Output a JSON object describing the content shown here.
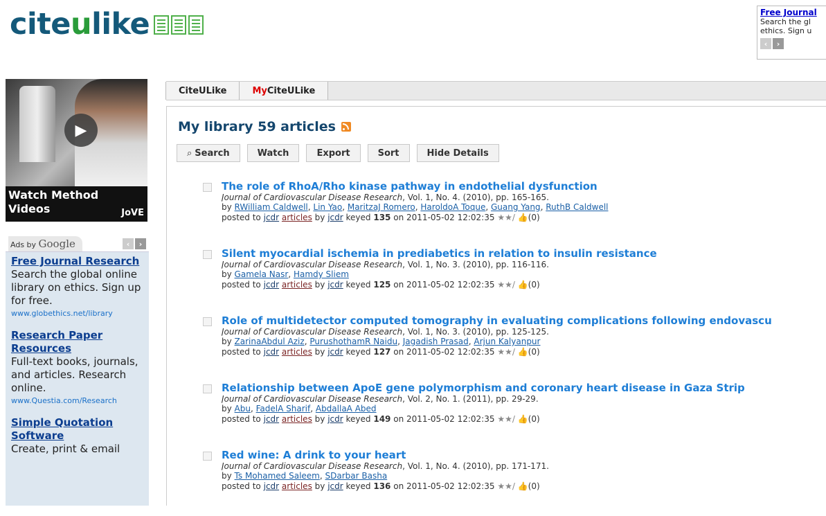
{
  "logo": {
    "pre": "cite",
    "u": "u",
    "post": "like"
  },
  "top_ad": {
    "title": "Free Journal",
    "line1": "Search the gl",
    "line2": "ethics. Sign u"
  },
  "video": {
    "caption_line1": "Watch Method",
    "caption_line2": "Videos",
    "brand": "JoVE"
  },
  "ads": {
    "label": "Ads by",
    "brand": "Google",
    "items": [
      {
        "title": "Free Journal Research",
        "body": "Search the global online library on ethics. Sign up for free.",
        "url": "www.globethics.net/library"
      },
      {
        "title": "Research Paper Resources",
        "body": "Full-text books, journals, and articles. Research online.",
        "url": "www.Questia.com/Research"
      },
      {
        "title": "Simple Quotation Software",
        "body": "Create, print & email",
        "url": ""
      }
    ]
  },
  "tabs": {
    "citeulike": "CiteULike",
    "my_prefix": "My",
    "my_rest": "CiteULike"
  },
  "library": {
    "title": "My library 59 articles"
  },
  "toolbar": {
    "search": "Search",
    "watch": "Watch",
    "export": "Export",
    "sort": "Sort",
    "hide": "Hide Details"
  },
  "articles": [
    {
      "title": "The role of RhoA/Rho kinase pathway in endothelial dysfunction",
      "journal": "Journal of Cardiovascular Disease Research",
      "details": ", Vol. 1, No. 4. (2010), pp. 165-165.",
      "authors": [
        "RWilliam Caldwell",
        "Lin Yao",
        "MaritzaJ Romero",
        "HaroldoA Toque",
        "Guang Yang",
        "RuthB Caldwell"
      ],
      "group": "jcdr",
      "tag": "articles",
      "user": "jcdr",
      "key": "135",
      "date": "2011-05-02 12:02:35",
      "likes": "(0)"
    },
    {
      "title": "Silent myocardial ischemia in prediabetics in relation to insulin resistance",
      "journal": "Journal of Cardiovascular Disease Research",
      "details": ", Vol. 1, No. 3. (2010), pp. 116-116.",
      "authors": [
        "Gamela Nasr",
        "Hamdy Sliem"
      ],
      "group": "jcdr",
      "tag": "articles",
      "user": "jcdr",
      "key": "125",
      "date": "2011-05-02 12:02:35",
      "likes": "(0)"
    },
    {
      "title": "Role of multidetector computed tomography in evaluating complications following endovascu",
      "journal": "Journal of Cardiovascular Disease Research",
      "details": ", Vol. 1, No. 3. (2010), pp. 125-125.",
      "authors": [
        "ZarinaAbdul Aziz",
        "PurushothamR Naidu",
        "Jagadish Prasad",
        "Arjun Kalyanpur"
      ],
      "group": "jcdr",
      "tag": "articles",
      "user": "jcdr",
      "key": "127",
      "date": "2011-05-02 12:02:35",
      "likes": "(0)"
    },
    {
      "title": "Relationship between ApoE gene polymorphism and coronary heart disease in Gaza Strip",
      "journal": "Journal of Cardiovascular Disease Research",
      "details": ", Vol. 2, No. 1. (2011), pp. 29-29.",
      "authors": [
        "Abu",
        "FadelA Sharif",
        "AbdallaA Abed"
      ],
      "group": "jcdr",
      "tag": "articles",
      "user": "jcdr",
      "key": "149",
      "date": "2011-05-02 12:02:35",
      "likes": "(0)"
    },
    {
      "title": "Red wine: A drink to your heart",
      "journal": "Journal of Cardiovascular Disease Research",
      "details": ", Vol. 1, No. 4. (2010), pp. 171-171.",
      "authors": [
        "Ts Mohamed Saleem",
        "SDarbar Basha"
      ],
      "group": "jcdr",
      "tag": "articles",
      "user": "jcdr",
      "key": "136",
      "date": "2011-05-02 12:02:35",
      "likes": "(0)"
    }
  ],
  "labels": {
    "by": "by",
    "posted_to": "posted to",
    "by_user": "by",
    "keyed": "keyed",
    "on": "on",
    "stars": "★★/"
  }
}
